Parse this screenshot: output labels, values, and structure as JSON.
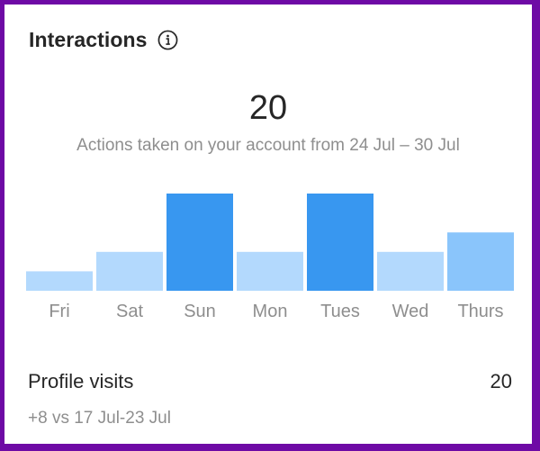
{
  "card": {
    "title": "Interactions",
    "info_icon": "info-circle-icon",
    "total": "20",
    "subtitle": "Actions taken on your account from 24 Jul – 30 Jul"
  },
  "footer": {
    "label": "Profile visits",
    "value": "20",
    "comparison": "+8 vs 17 Jul-23 Jul"
  },
  "colors": {
    "frame": "#6e0aa5",
    "bar_high": "#3897f0",
    "bar_mid": "#8ac5fb",
    "bar_low": "#b3d9fd"
  },
  "chart_data": {
    "type": "bar",
    "title": "Interactions",
    "xlabel": "",
    "ylabel": "",
    "categories": [
      "Fri",
      "Sat",
      "Sun",
      "Mon",
      "Tues",
      "Wed",
      "Thurs"
    ],
    "values": [
      1,
      2,
      5,
      2,
      5,
      2,
      3
    ],
    "ylim": [
      0,
      5
    ],
    "grid": false,
    "legend": "none"
  }
}
